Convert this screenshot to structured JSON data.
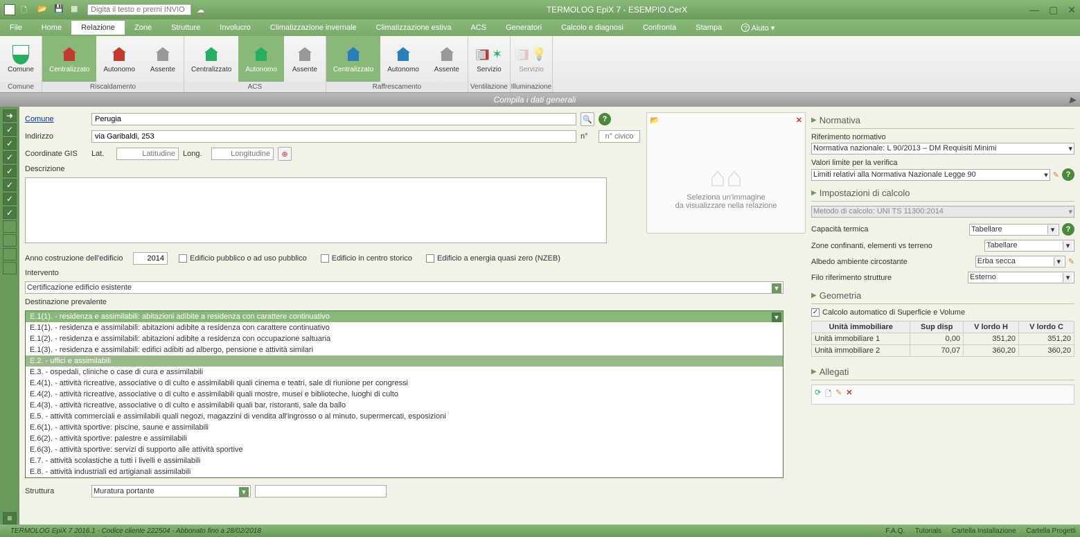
{
  "titlebar": {
    "search_placeholder": "Digita il testo e premi INVIO",
    "title": "TERMOLOG EpiX 7 - ESEMPIO.CerX"
  },
  "menubar": {
    "items": [
      "File",
      "Home",
      "Relazione",
      "Zone",
      "Strutture",
      "Involucro",
      "Climatizzazione invernale",
      "Climatizzazione estiva",
      "ACS",
      "Generatori",
      "Calcolo e diagnosi",
      "Confronta",
      "Stampa"
    ],
    "help": "Aiuto",
    "active_index": 2
  },
  "ribbon": {
    "groups": [
      {
        "label": "Comune",
        "items": [
          {
            "label": "Comune",
            "icon": "shield"
          }
        ]
      },
      {
        "label": "Riscaldamento",
        "items": [
          {
            "label": "Centralizzato",
            "icon": "house-red",
            "selected": true
          },
          {
            "label": "Autonomo",
            "icon": "house-red"
          },
          {
            "label": "Assente",
            "icon": "house-gray"
          }
        ]
      },
      {
        "label": "ACS",
        "items": [
          {
            "label": "Centralizzato",
            "icon": "house-green"
          },
          {
            "label": "Autonomo",
            "icon": "house-green",
            "selected": true
          },
          {
            "label": "Assente",
            "icon": "house-gray"
          }
        ]
      },
      {
        "label": "Raffrescamento",
        "items": [
          {
            "label": "Centralizzato",
            "icon": "house-blue",
            "selected": true
          },
          {
            "label": "Autonomo",
            "icon": "house-blue"
          },
          {
            "label": "Assente",
            "icon": "house-gray"
          }
        ]
      },
      {
        "label": "Ventilazione",
        "items": [
          {
            "label": "Servizio",
            "switch": "NO",
            "fan": true
          }
        ]
      },
      {
        "label": "Illuminazione",
        "items": [
          {
            "label": "Servizio",
            "switch": "NO",
            "bulb": true,
            "disabled": true
          }
        ]
      }
    ]
  },
  "subheader": "Compila i dati generali",
  "form": {
    "comune_label": "Comune",
    "comune_value": "Perugia",
    "indirizzo_label": "Indirizzo",
    "indirizzo_value": "via Garibaldi, 253",
    "n_label": "n°",
    "n_civico": "n° civico",
    "coord_label": "Coordinate GIS",
    "lat_label": "Lat.",
    "lat_ph": "Latitudine",
    "long_label": "Long.",
    "long_ph": "Longitudine",
    "desc_label": "Descrizione",
    "image_hint1": "Seleziona un'immagine",
    "image_hint2": "da visualizzare nella relazione",
    "anno_label": "Anno costruzione dell'edificio",
    "anno_value": "2014",
    "chk_pubblico": "Edificio pubblico o ad uso pubblico",
    "chk_storico": "Edificio in centro storico",
    "chk_nzeb": "Edificio a energia quasi zero (NZEB)",
    "intervento_label": "Intervento",
    "intervento_value": "Certificazione edificio esistente",
    "dest_label": "Destinazione prevalente",
    "dest_selected": "E.1(1).  - residenza e assimilabili: abitazioni adibite a residenza con carattere continuativo",
    "dest_options": [
      {
        "t": "E.1(1).  - residenza e assimilabili: abitazioni adibite a residenza con carattere continuativo"
      },
      {
        "t": "E.1(2).  - residenza e assimilabili: abitazioni adibite a residenza con occupazione saltuaria"
      },
      {
        "t": "E.1(3).  - residenza e assimilabili: edifici adibiti ad albergo, pensione e attività similari"
      },
      {
        "t": "E.2.     - uffici e assimilabili",
        "hl": true
      },
      {
        "t": "E.3.     - ospedali, cliniche o case di cura e assimilabili"
      },
      {
        "t": "E.4(1).  - attività ricreative, associative o di culto e assimilabili quali cinema e teatri, sale di riunione per congressi"
      },
      {
        "t": "E.4(2).  - attività ricreative, associative o di culto e assimilabili quali mostre, musei e biblioteche, luoghi di culto"
      },
      {
        "t": "E.4(3).  - attività ricreative, associative o di culto e assimilabili quali bar, ristoranti, sale da ballo"
      },
      {
        "t": "E.5.     - attività commerciali e assimilabili quali negozi, magazzini di vendita all'ingrosso o al minuto, supermercati, esposizioni"
      },
      {
        "t": "E.6(1).  - attività sportive: piscine, saune e assimilabili"
      },
      {
        "t": "E.6(2).  - attività sportive: palestre e assimilabili"
      },
      {
        "t": "E.6(3).  - attività sportive: servizi di supporto alle attività sportive"
      },
      {
        "t": "E.7.     - attività scolastiche a tutti i livelli e assimilabili"
      },
      {
        "t": "E.8.     - attività industriali ed artigianali assimilabili"
      }
    ],
    "struttura_label": "Struttura",
    "struttura_value": "Muratura portante"
  },
  "right": {
    "normativa_title": "Normativa",
    "rif_label": "Riferimento normativo",
    "rif_value": "Normativa nazionale: L 90/2013 – DM Requisiti Minimi",
    "valori_label": "Valori limite per la verifica",
    "valori_value": "Limiti relativi alla Normativa Nazionale Legge 90",
    "impost_title": "Impostazioni di calcolo",
    "metodo_value": "Metodo di calcolo: UNI TS 11300:2014",
    "cap_label": "Capacità termica",
    "cap_value": "Tabellare",
    "zone_label": "Zone confinanti, elementi vs terreno",
    "zone_value": "Tabellare",
    "albedo_label": "Albedo ambiente circostante",
    "albedo_value": "Erba secca",
    "filo_label": "Filo riferimento strutture",
    "filo_value": "Esterno",
    "geo_title": "Geometria",
    "geo_chk": "Calcolo automatico di Superficie e Volume",
    "geo_headers": [
      "Unità immobiliare",
      "Sup disp",
      "V lordo H",
      "V lordo C"
    ],
    "geo_rows": [
      [
        "Unità immobiliare 1",
        "0,00",
        "351,20",
        "351,20"
      ],
      [
        "Unità immobiliare 2",
        "70,07",
        "360,20",
        "360,20"
      ]
    ],
    "allegati_title": "Allegati"
  },
  "statusbar": {
    "left": "TERMOLOG EpiX 7 2016.1 - Codice cliente 222504 - Abbonato fino a 28/02/2018",
    "links": [
      "F.A.Q.",
      "Tutorials",
      "Cartella Installazione",
      "Cartella Progetti"
    ]
  }
}
